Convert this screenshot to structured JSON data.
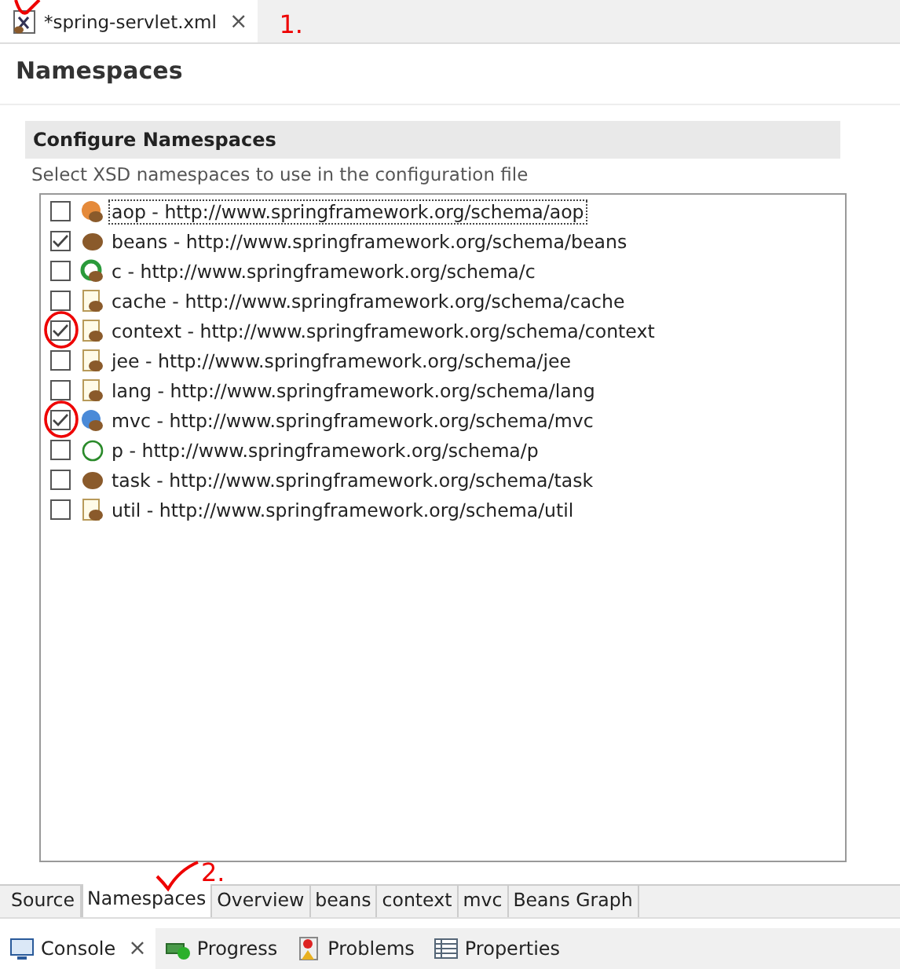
{
  "editor_tab": {
    "title": "*spring-servlet.xml",
    "close": "×",
    "selected": true
  },
  "page_title": "Namespaces",
  "section": {
    "title": "Configure Namespaces",
    "description": "Select XSD namespaces to use in the configuration file"
  },
  "namespaces": [
    {
      "label": "aop - http://www.springframework.org/schema/aop",
      "checked": false,
      "selected": true
    },
    {
      "label": "beans - http://www.springframework.org/schema/beans",
      "checked": true,
      "selected": false
    },
    {
      "label": "c - http://www.springframework.org/schema/c",
      "checked": false,
      "selected": false
    },
    {
      "label": "cache - http://www.springframework.org/schema/cache",
      "checked": false,
      "selected": false
    },
    {
      "label": "context - http://www.springframework.org/schema/context",
      "checked": true,
      "selected": false
    },
    {
      "label": "jee - http://www.springframework.org/schema/jee",
      "checked": false,
      "selected": false
    },
    {
      "label": "lang - http://www.springframework.org/schema/lang",
      "checked": false,
      "selected": false
    },
    {
      "label": "mvc - http://www.springframework.org/schema/mvc",
      "checked": true,
      "selected": false
    },
    {
      "label": "p - http://www.springframework.org/schema/p",
      "checked": false,
      "selected": false
    },
    {
      "label": "task - http://www.springframework.org/schema/task",
      "checked": false,
      "selected": false
    },
    {
      "label": "util - http://www.springframework.org/schema/util",
      "checked": false,
      "selected": false
    }
  ],
  "page_tabs": [
    {
      "label": "Source",
      "selected": false
    },
    {
      "label": "Namespaces",
      "selected": true
    },
    {
      "label": "Overview",
      "selected": false
    },
    {
      "label": "beans",
      "selected": false
    },
    {
      "label": "context",
      "selected": false
    },
    {
      "label": "mvc",
      "selected": false
    },
    {
      "label": "Beans Graph",
      "selected": false
    }
  ],
  "view_tabs": [
    {
      "label": "Console",
      "selected": true,
      "close": "×"
    },
    {
      "label": "Progress",
      "selected": false
    },
    {
      "label": "Problems",
      "selected": false
    },
    {
      "label": "Properties",
      "selected": false
    }
  ],
  "annotations": [
    {
      "text": "1."
    },
    {
      "text": "2."
    }
  ]
}
